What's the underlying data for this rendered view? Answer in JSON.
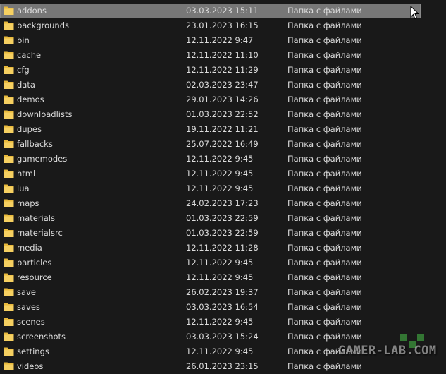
{
  "file_list": {
    "folder_type_label": "Папка с файлами",
    "selected_index": 0,
    "items": [
      {
        "name": "addons",
        "modified": "03.03.2023 15:11",
        "type": "Папка с файлами"
      },
      {
        "name": "backgrounds",
        "modified": "23.01.2023 16:15",
        "type": "Папка с файлами"
      },
      {
        "name": "bin",
        "modified": "12.11.2022 9:47",
        "type": "Папка с файлами"
      },
      {
        "name": "cache",
        "modified": "12.11.2022 11:10",
        "type": "Папка с файлами"
      },
      {
        "name": "cfg",
        "modified": "12.11.2022 11:29",
        "type": "Папка с файлами"
      },
      {
        "name": "data",
        "modified": "02.03.2023 23:47",
        "type": "Папка с файлами"
      },
      {
        "name": "demos",
        "modified": "29.01.2023 14:26",
        "type": "Папка с файлами"
      },
      {
        "name": "downloadlists",
        "modified": "01.03.2023 22:52",
        "type": "Папка с файлами"
      },
      {
        "name": "dupes",
        "modified": "19.11.2022 11:21",
        "type": "Папка с файлами"
      },
      {
        "name": "fallbacks",
        "modified": "25.07.2022 16:49",
        "type": "Папка с файлами"
      },
      {
        "name": "gamemodes",
        "modified": "12.11.2022 9:45",
        "type": "Папка с файлами"
      },
      {
        "name": "html",
        "modified": "12.11.2022 9:45",
        "type": "Папка с файлами"
      },
      {
        "name": "lua",
        "modified": "12.11.2022 9:45",
        "type": "Папка с файлами"
      },
      {
        "name": "maps",
        "modified": "24.02.2023 17:23",
        "type": "Папка с файлами"
      },
      {
        "name": "materials",
        "modified": "01.03.2023 22:59",
        "type": "Папка с файлами"
      },
      {
        "name": "materialsrc",
        "modified": "01.03.2023 22:59",
        "type": "Папка с файлами"
      },
      {
        "name": "media",
        "modified": "12.11.2022 11:28",
        "type": "Папка с файлами"
      },
      {
        "name": "particles",
        "modified": "12.11.2022 9:45",
        "type": "Папка с файлами"
      },
      {
        "name": "resource",
        "modified": "12.11.2022 9:45",
        "type": "Папка с файлами"
      },
      {
        "name": "save",
        "modified": "26.02.2023 19:37",
        "type": "Папка с файлами"
      },
      {
        "name": "saves",
        "modified": "03.03.2023 16:54",
        "type": "Папка с файлами"
      },
      {
        "name": "scenes",
        "modified": "12.11.2022 9:45",
        "type": "Папка с файлами"
      },
      {
        "name": "screenshots",
        "modified": "03.03.2023 15:24",
        "type": "Папка с файлами"
      },
      {
        "name": "settings",
        "modified": "12.11.2022 9:45",
        "type": "Папка с файлами"
      },
      {
        "name": "videos",
        "modified": "26.01.2023 23:15",
        "type": "Папка с файлами"
      }
    ]
  },
  "watermark": {
    "text": "GAMER-LAB.COM"
  },
  "colors": {
    "background": "#191919",
    "text": "#dcdcdc",
    "selection": "#777777",
    "folder_body": "#e8b93c",
    "folder_front": "#f6d061"
  },
  "icons": {
    "folder": "folder-icon",
    "cursor": "mouse-pointer-icon"
  }
}
